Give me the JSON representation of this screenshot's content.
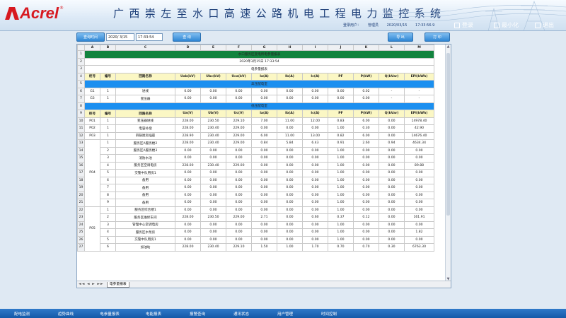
{
  "header": {
    "logo_text": "Acrel",
    "logo_reg": "®",
    "system_title": "广西崇左至水口高速公路机电工程电力监控系统",
    "login_label": "登录用户：",
    "login_user": "管理员",
    "date": "2020/03/15",
    "time": "17:33:56.9",
    "btn_login": "登录",
    "btn_minimize": "最小化",
    "btn_exit": "退出"
  },
  "query": {
    "query_time_button": "查询时间",
    "date_value": "2020/ 3/15",
    "time_value": "17:33:54",
    "query_button": "查 询",
    "export_button": "导 出",
    "print_button": "打 印"
  },
  "sheet": {
    "col_letters": [
      "A",
      "B",
      "C",
      "D",
      "E",
      "F",
      "G",
      "H",
      "I",
      "J",
      "K",
      "L",
      "M"
    ],
    "report_title": "水口服务区变电所电参量报表",
    "report_time": "2020年3月15日 17:33:54",
    "report_subtitle": "电参量报表",
    "head1": [
      "柜号",
      "编号",
      "回路名称",
      "Uab(kV)",
      "Ubc(kV)",
      "Uca(kV)",
      "Ia(A)",
      "Ib(A)",
      "Ic(A)",
      "PF",
      "P(kW)",
      "Q(kVar)",
      "EPI(kWh)"
    ],
    "section_high": "高压配电室",
    "high_rows": [
      [
        "G1",
        "1",
        "进线",
        "0.00",
        "0.00",
        "0.00",
        "0.00",
        "0.00",
        "0.00",
        "0.00",
        "0.02",
        "-",
        "-"
      ],
      [
        "G3",
        "1",
        "变压器",
        "0.00",
        "0.00",
        "0.00",
        "0.00",
        "0.00",
        "0.00",
        "0.00",
        "0.00",
        "-",
        "-"
      ]
    ],
    "section_low": "低压配电室",
    "head2": [
      "柜号",
      "编号",
      "回路名称",
      "Ua(V)",
      "Ub(V)",
      "Uc(V)",
      "Ia(A)",
      "Ib(A)",
      "Ic(A)",
      "PF",
      "P(kW)",
      "Q(kVar)",
      "EPI(kWh)"
    ],
    "low_rows": [
      [
        "P01",
        "1",
        "变压器进线",
        "228.00",
        "230.50",
        "229.10",
        "7.00",
        "11.00",
        "12.00",
        "0.83",
        "6.00",
        "0.00",
        "14978.40"
      ],
      [
        "P02",
        "1",
        "电容补偿",
        "228.00",
        "230.40",
        "229.00",
        "0.00",
        "0.00",
        "0.00",
        "1.00",
        "0.30",
        "0.00",
        "42.90"
      ],
      [
        "P03",
        "1",
        "四锅厨房插座",
        "228.90",
        "230.40",
        "229.00",
        "6.00",
        "11.00",
        "13.00",
        "0.82",
        "6.00",
        "0.00",
        "14676.40"
      ],
      [
        "",
        "1",
        "服务区A服务楼2",
        "228.00",
        "230.40",
        "229.00",
        "0.84",
        "5.84",
        "6.43",
        "0.91",
        "2.60",
        "0.94",
        "4634.34"
      ],
      [
        "",
        "2",
        "服务区A服务楼3",
        "0.00",
        "0.00",
        "0.00",
        "0.00",
        "0.00",
        "0.00",
        "1.00",
        "0.00",
        "0.00",
        "0.00"
      ],
      [
        "",
        "3",
        "消防水池",
        "0.00",
        "0.00",
        "0.00",
        "0.00",
        "0.00",
        "0.00",
        "1.00",
        "0.00",
        "0.00",
        "0.00"
      ],
      [
        "",
        "4",
        "服务区空调电房",
        "228.00",
        "230.40",
        "229.00",
        "0.00",
        "0.00",
        "0.00",
        "1.00",
        "0.00",
        "0.00",
        "89.88"
      ],
      [
        "P04",
        "5",
        "交警中队用房1",
        "0.00",
        "0.00",
        "0.00",
        "0.00",
        "0.00",
        "0.00",
        "1.00",
        "0.00",
        "0.00",
        "0.00"
      ],
      [
        "",
        "6",
        "备用",
        "0.00",
        "0.00",
        "0.00",
        "0.00",
        "0.00",
        "0.00",
        "1.00",
        "0.00",
        "0.00",
        "0.00"
      ],
      [
        "",
        "7",
        "备用",
        "0.00",
        "0.00",
        "0.00",
        "0.00",
        "0.00",
        "0.00",
        "1.00",
        "0.00",
        "0.00",
        "0.00"
      ],
      [
        "",
        "8",
        "备用",
        "0.00",
        "0.00",
        "0.00",
        "0.00",
        "0.00",
        "0.00",
        "1.00",
        "0.00",
        "0.00",
        "0.00"
      ],
      [
        "",
        "9",
        "备用",
        "0.00",
        "0.00",
        "0.00",
        "0.00",
        "0.00",
        "0.00",
        "1.00",
        "0.00",
        "0.00",
        "0.00"
      ],
      [
        "",
        "1",
        "服务区综合楼1",
        "0.00",
        "0.00",
        "0.00",
        "0.00",
        "0.00",
        "0.00",
        "1.00",
        "0.00",
        "0.00",
        "0.00"
      ],
      [
        "",
        "2",
        "服务区维修车间",
        "228.00",
        "230.50",
        "229.00",
        "2.71",
        "0.00",
        "0.60",
        "0.37",
        "0.12",
        "0.00",
        "161.91"
      ],
      [
        "",
        "3",
        "管理中心空调电房",
        "0.00",
        "0.00",
        "0.00",
        "0.00",
        "0.00",
        "0.00",
        "1.00",
        "0.00",
        "0.00",
        "0.00"
      ],
      [
        "",
        "4",
        "服务区水泵房",
        "0.00",
        "0.00",
        "0.00",
        "0.00",
        "0.00",
        "0.00",
        "1.00",
        "0.00",
        "0.00",
        "1.82"
      ],
      [
        "P05",
        "5",
        "交警中队用房1",
        "0.00",
        "0.00",
        "0.00",
        "0.00",
        "0.00",
        "0.00",
        "1.00",
        "0.00",
        "0.00",
        "0.00"
      ],
      [
        "",
        "6",
        "加油站",
        "228.00",
        "230.40",
        "229.10",
        "1.50",
        "1.00",
        "1.70",
        "0.70",
        "0.70",
        "0.30",
        "6763.30"
      ]
    ],
    "tab_nav": "◄◄ ◄ ► ►►",
    "tab_name": "电参量报表"
  },
  "bottom_nav": [
    "配电监测",
    "趋势曲线",
    "电参量报表",
    "电能报表",
    "报警查询",
    "通讯状态",
    "用户管理",
    "时间控制"
  ]
}
